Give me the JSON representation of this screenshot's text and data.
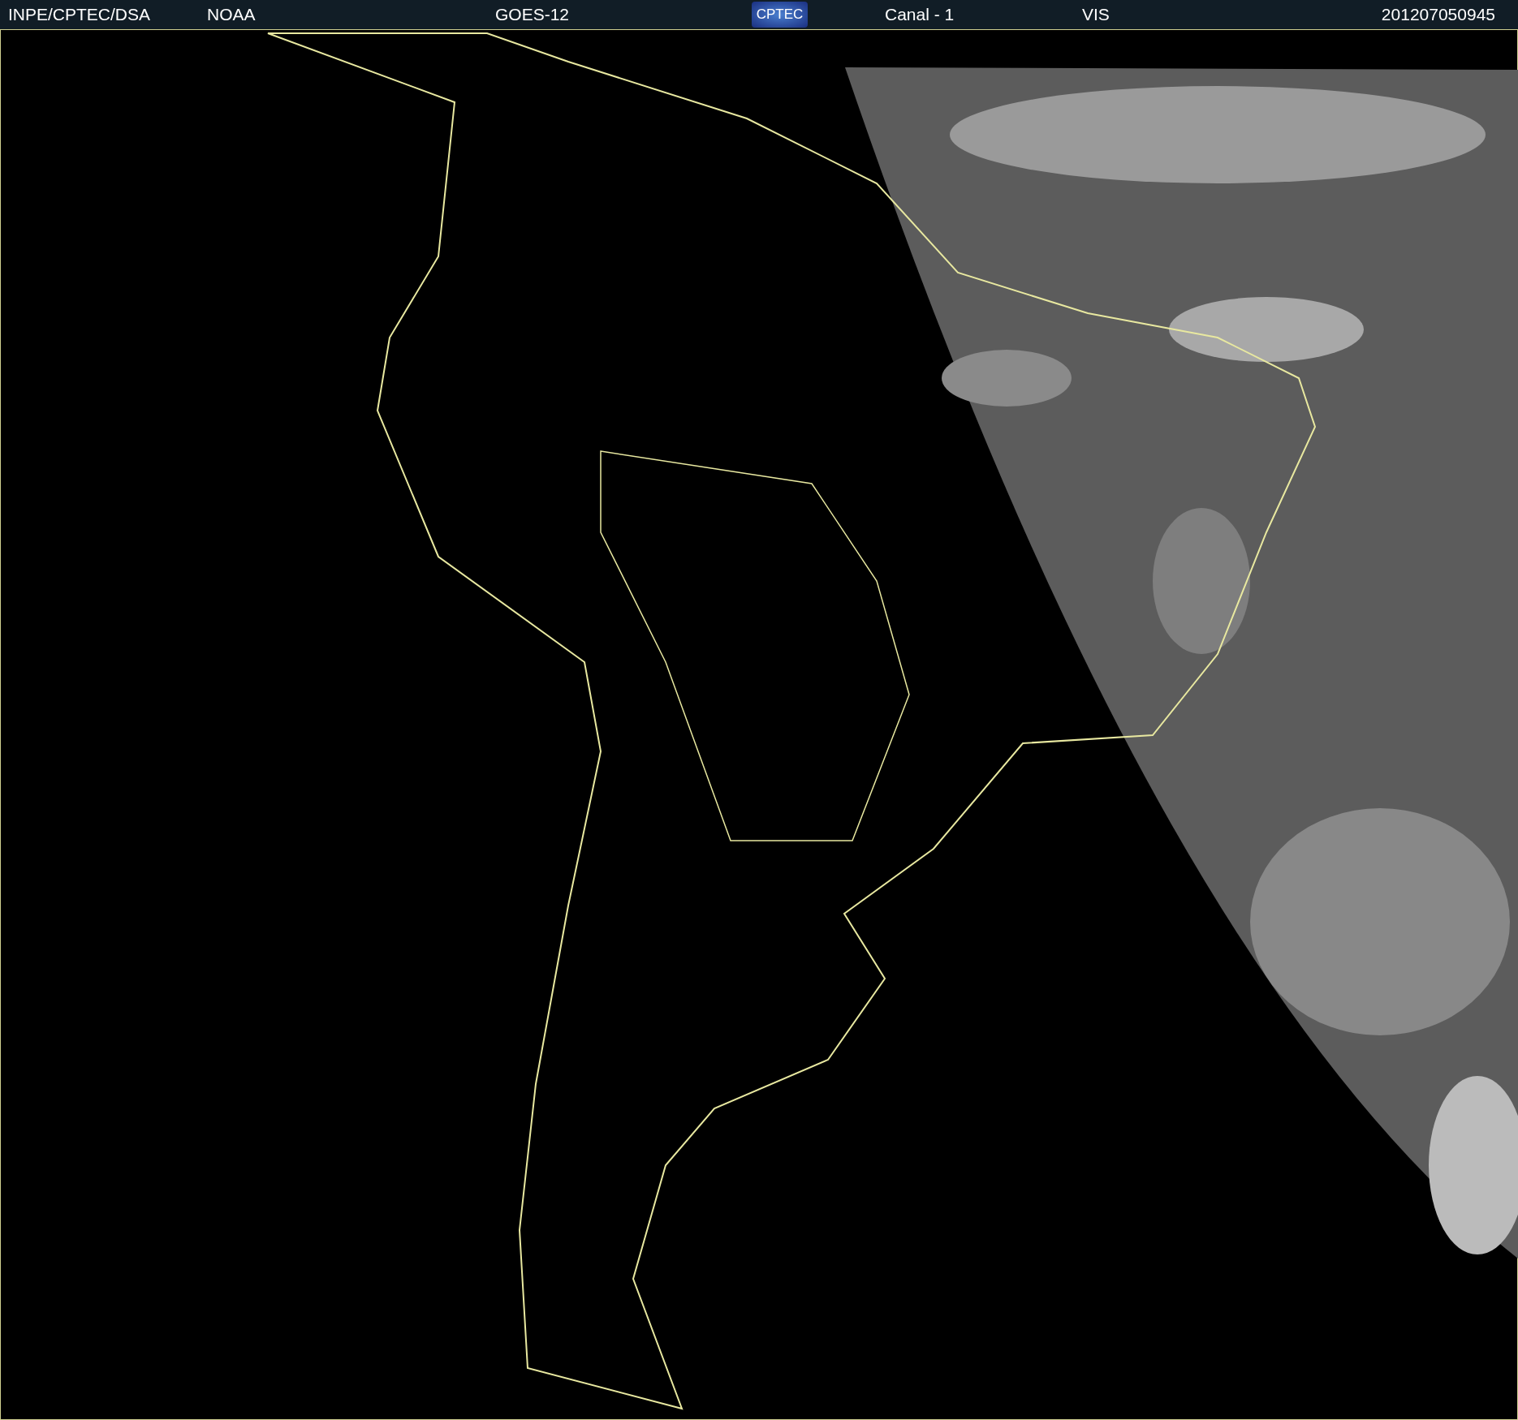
{
  "header": {
    "agency": "INPE/CPTEC/DSA",
    "source": "NOAA",
    "satellite": "GOES-12",
    "logo": "CPTEC",
    "channel": "Canal - 1",
    "band": "VIS",
    "timestamp": "201207050945"
  }
}
